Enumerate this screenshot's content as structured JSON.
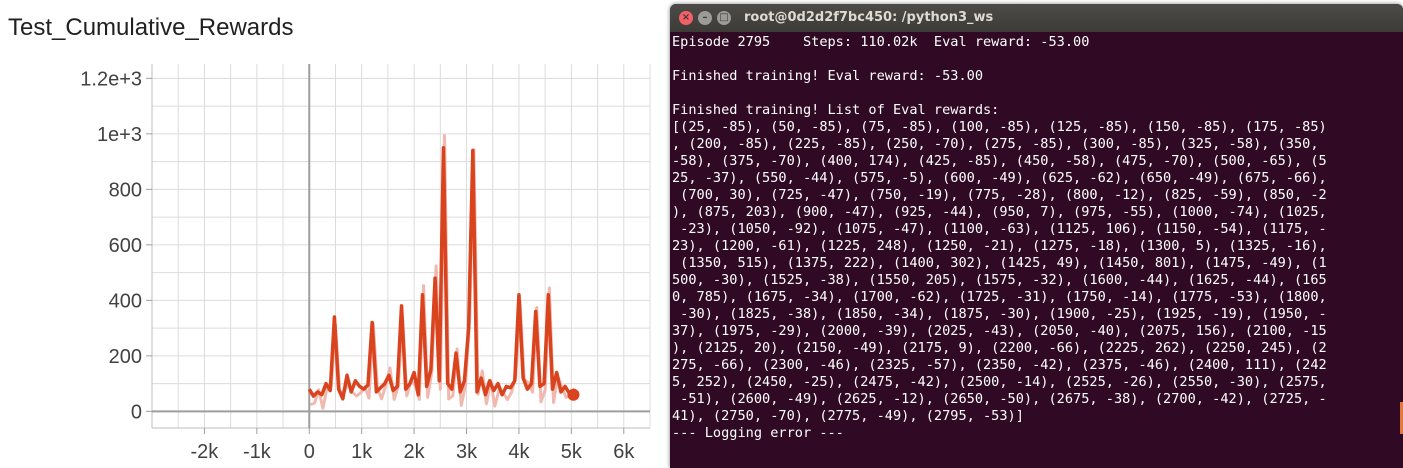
{
  "chart": {
    "title": "Test_Cumulative_Rewards",
    "colors": {
      "series": "#d9431e",
      "raw": "#f0b0a6",
      "grid": "#dcdcdc",
      "axis": "#9e9e9e"
    }
  },
  "chart_data": {
    "type": "line",
    "title": "Test_Cumulative_Rewards",
    "xlabel": "",
    "ylabel": "",
    "xlim": [
      -3000,
      6500
    ],
    "ylim": [
      -60,
      1230
    ],
    "xticks": [
      -2000,
      -1000,
      0,
      1000,
      2000,
      3000,
      4000,
      5000,
      6000
    ],
    "xtick_labels": [
      "-2k",
      "-1k",
      "0",
      "1k",
      "2k",
      "3k",
      "4k",
      "5k",
      "6k"
    ],
    "yticks": [
      0,
      200,
      400,
      600,
      800,
      1000,
      1200
    ],
    "ytick_labels": [
      "0",
      "200",
      "400",
      "600",
      "800",
      "1e+3",
      "1.2e+3"
    ],
    "grid": true,
    "series": [
      {
        "x": [
          0,
          80,
          160,
          240,
          320,
          400,
          480,
          560,
          640,
          720,
          800,
          880,
          960,
          1040,
          1120,
          1200,
          1280,
          1360,
          1440,
          1520,
          1600,
          1680,
          1760,
          1840,
          1920,
          2000,
          2080,
          2160,
          2240,
          2320,
          2400,
          2480,
          2560,
          2640,
          2720,
          2800,
          2880,
          2960,
          3040,
          3120,
          3200,
          3280,
          3360,
          3440,
          3520,
          3600,
          3680,
          3760,
          3840,
          3920,
          4000,
          4080,
          4160,
          4240,
          4320,
          4400,
          4480,
          4560,
          4640,
          4720,
          4800,
          4880,
          4960,
          5040
        ],
        "y": [
          80,
          55,
          70,
          60,
          100,
          75,
          340,
          80,
          45,
          130,
          70,
          110,
          90,
          80,
          95,
          320,
          70,
          85,
          100,
          130,
          75,
          90,
          380,
          80,
          100,
          140,
          60,
          420,
          90,
          150,
          480,
          110,
          950,
          100,
          80,
          210,
          70,
          110,
          300,
          940,
          70,
          120,
          60,
          110,
          75,
          100,
          60,
          90,
          85,
          110,
          420,
          120,
          80,
          100,
          360,
          90,
          100,
          420,
          80,
          140,
          70,
          90,
          65,
          60
        ]
      }
    ]
  },
  "terminal": {
    "window_title": "root@0d2d2f7bc450: /python3_ws",
    "close_glyph": "×",
    "min_glyph": "–",
    "max_glyph": "□",
    "lines": [
      "Episode 2795    Steps: 110.02k  Eval reward: -53.00",
      "",
      "Finished training! Eval reward: -53.00",
      "",
      "Finished training! List of Eval rewards:",
      "[(25, -85), (50, -85), (75, -85), (100, -85), (125, -85), (150, -85), (175, -85)",
      ", (200, -85), (225, -85), (250, -70), (275, -85), (300, -85), (325, -58), (350,",
      "-58), (375, -70), (400, 174), (425, -85), (450, -58), (475, -70), (500, -65), (5",
      "25, -37), (550, -44), (575, -5), (600, -49), (625, -62), (650, -49), (675, -66),",
      " (700, 30), (725, -47), (750, -19), (775, -28), (800, -12), (825, -59), (850, -2",
      "), (875, 203), (900, -47), (925, -44), (950, 7), (975, -55), (1000, -74), (1025,",
      " -23), (1050, -92), (1075, -47), (1100, -63), (1125, 106), (1150, -54), (1175, -",
      "23), (1200, -61), (1225, 248), (1250, -21), (1275, -18), (1300, 5), (1325, -16),",
      " (1350, 515), (1375, 222), (1400, 302), (1425, 49), (1450, 801), (1475, -49), (1",
      "500, -30), (1525, -38), (1550, 205), (1575, -32), (1600, -44), (1625, -44), (165",
      "0, 785), (1675, -34), (1700, -62), (1725, -31), (1750, -14), (1775, -53), (1800,",
      " -30), (1825, -38), (1850, -34), (1875, -30), (1900, -25), (1925, -19), (1950, -",
      "37), (1975, -29), (2000, -39), (2025, -43), (2050, -40), (2075, 156), (2100, -15",
      "), (2125, 20), (2150, -49), (2175, 9), (2200, -66), (2225, 262), (2250, 245), (2",
      "275, -66), (2300, -46), (2325, -57), (2350, -42), (2375, -46), (2400, 111), (242",
      "5, 252), (2450, -25), (2475, -42), (2500, -14), (2525, -26), (2550, -30), (2575,",
      " -51), (2600, -49), (2625, -12), (2650, -50), (2675, -38), (2700, -42), (2725, -",
      "41), (2750, -70), (2775, -49), (2795, -53)]",
      "--- Logging error ---"
    ]
  }
}
